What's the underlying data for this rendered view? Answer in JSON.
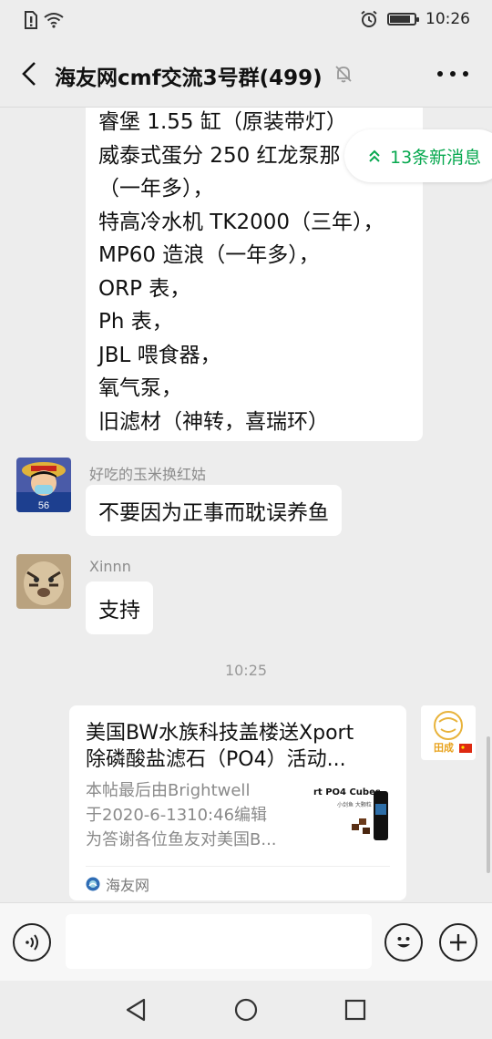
{
  "status_bar": {
    "time": "10:26"
  },
  "header": {
    "title": "海友网cmf交流3号群(499)"
  },
  "top_message": {
    "lines": [
      "睿堡 1.55 缸（原装带灯）",
      "威泰式蛋分 250 红龙泵那",
      "（一年多），",
      "特高冷水机 TK2000（三年），",
      "MP60 造浪（一年多），",
      "ORP 表，",
      "Ph 表，",
      "JBL 喂食器，",
      "氧气泵，",
      "旧滤材（神转，喜瑞环）"
    ]
  },
  "new_messages": {
    "label": "13条新消息"
  },
  "messages": [
    {
      "sender": "好吃的玉米换红姑",
      "text": "不要因为正事而耽误养鱼"
    },
    {
      "sender": "Xinnn",
      "text": "支持"
    }
  ],
  "timestamp": "10:25",
  "link_card": {
    "title_lines": [
      "美国BW水族科技盖楼送Xport",
      "除磷酸盐滤石（PO4）活动..."
    ],
    "desc_lines": [
      "本帖最后由Brightwell",
      "于2020-6-1310:46编辑",
      "为答谢各位鱼友对美国B..."
    ],
    "thumb_text": "rt PO4 Cubes",
    "thumb_subtext": "小剑鱼 大颗粒",
    "source": "海友网"
  },
  "self_avatar_text": "田成",
  "input": {
    "placeholder": ""
  },
  "colors": {
    "accent_green": "#07a84f",
    "background": "#ededed"
  }
}
